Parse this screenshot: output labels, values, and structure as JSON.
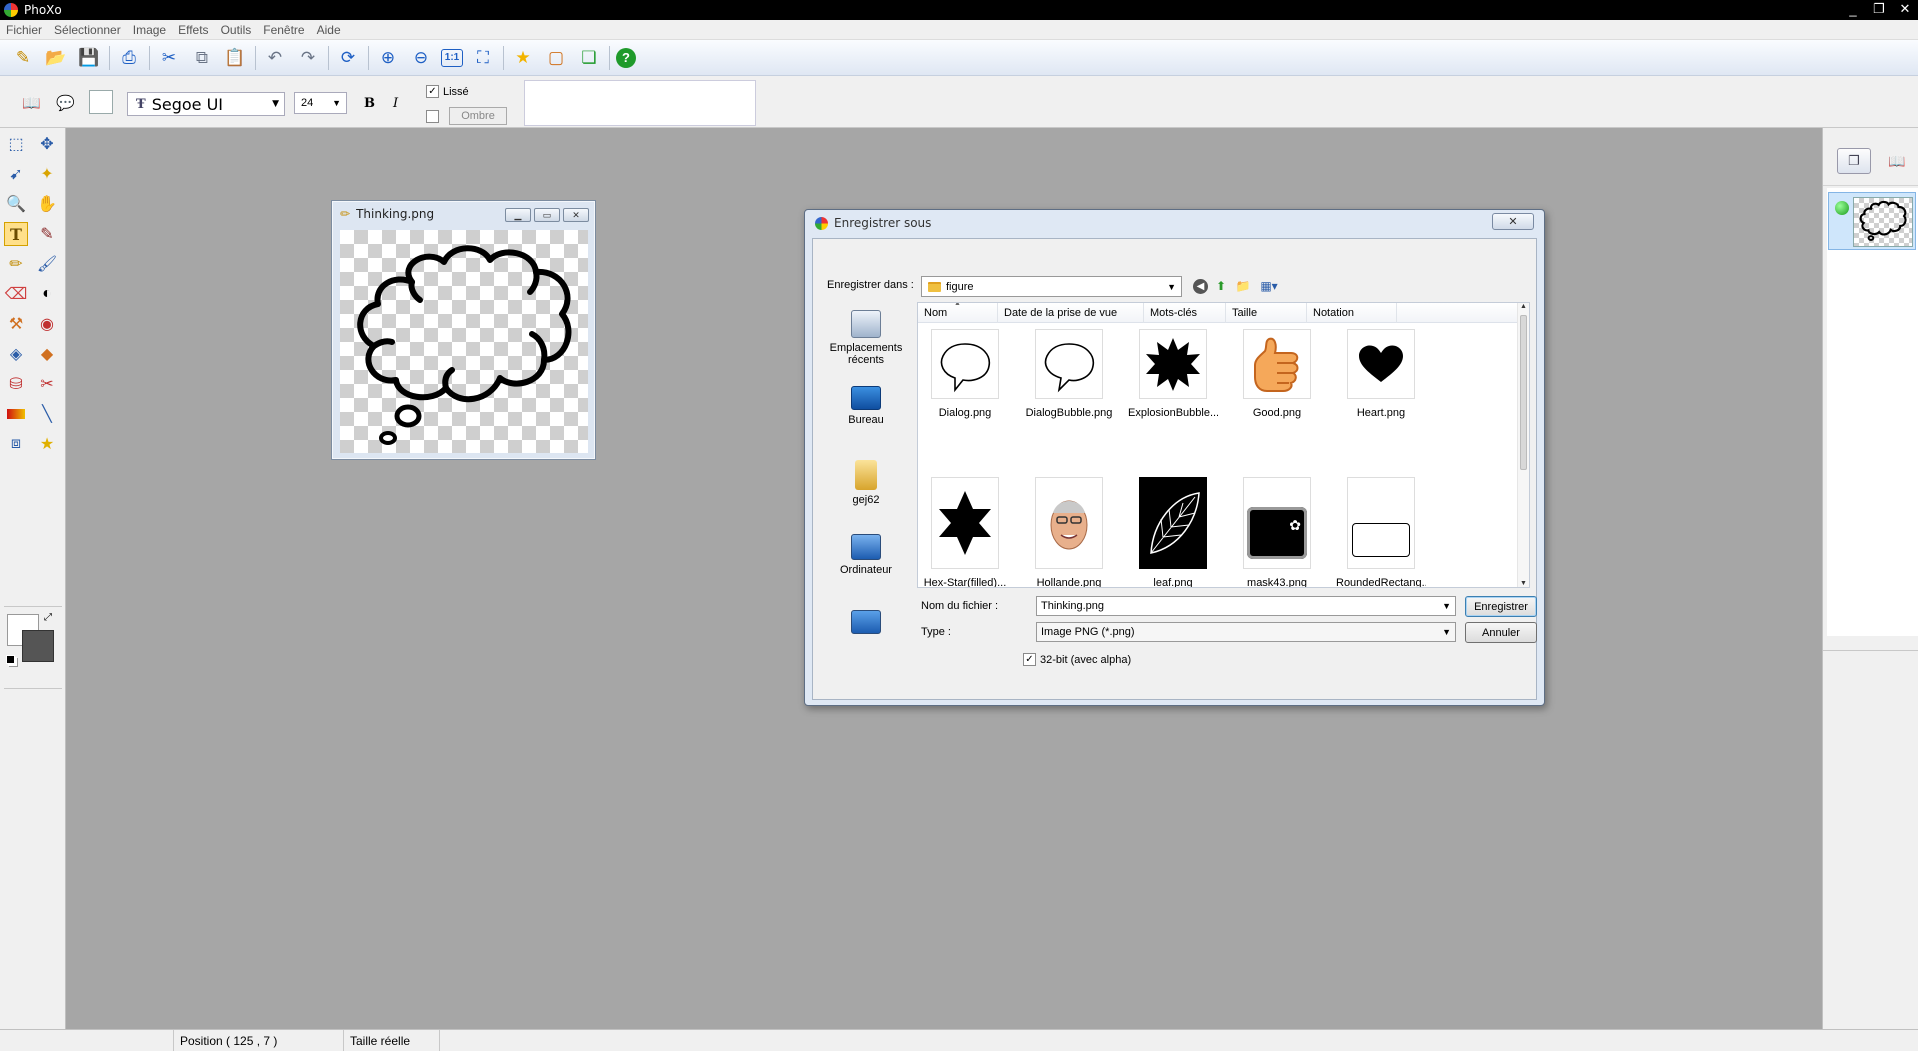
{
  "window": {
    "title": "PhoXo",
    "minimize": "_",
    "restore": "❐",
    "close": "✕"
  },
  "menu": [
    "Fichier",
    "Sélectionner",
    "Image",
    "Effets",
    "Outils",
    "Fenêtre",
    "Aide"
  ],
  "toolbar_icons": [
    "new-file-icon",
    "open-folder-icon",
    "save-icon",
    "print-icon",
    "cut-icon",
    "copy-icon",
    "paste-icon",
    "undo-icon",
    "redo-icon",
    "refresh-icon",
    "zoom-in-icon",
    "zoom-out-icon",
    "actual-size-icon",
    "fit-window-icon",
    "favorite-star-icon",
    "frame-icon",
    "layers-icon",
    "help-icon"
  ],
  "text_options": {
    "font": "Segoe UI",
    "font_glyph": "Ŧ",
    "size": "24",
    "bold": "B",
    "italic": "I",
    "lisse_label": "Lissé",
    "lisse_checked": true,
    "ombre_label": "Ombre",
    "ombre_checked": false
  },
  "document": {
    "title": "Thinking.png"
  },
  "dialog": {
    "title": "Enregistrer sous",
    "close": "✕",
    "save_in_label": "Enregistrer dans :",
    "save_in_value": "figure",
    "places": [
      {
        "label": "Emplacements récents"
      },
      {
        "label": "Bureau"
      },
      {
        "label": "gej62"
      },
      {
        "label": "Ordinateur"
      },
      {
        "label": ""
      }
    ],
    "columns": [
      "Nom",
      "Date de la prise de vue",
      "Mots-clés",
      "Taille",
      "Notation"
    ],
    "files_row1": [
      "Dialog.png",
      "DialogBubble.png",
      "ExplosionBubble...",
      "Good.png",
      "Heart.png"
    ],
    "files_row2": [
      "Hex-Star(filled)...",
      "Hollande.png",
      "leaf.png",
      "mask43.png",
      "RoundedRectang..."
    ],
    "filename_label": "Nom du fichier :",
    "filename_value": "Thinking.png",
    "type_label": "Type :",
    "type_value": "Image PNG (*.png)",
    "save_button": "Enregistrer",
    "cancel_button": "Annuler",
    "alpha_label": "32-bit (avec alpha)",
    "alpha_checked": true
  },
  "status": {
    "position": "Position ( 125 , 7 )",
    "zoom": "Taille réelle"
  }
}
